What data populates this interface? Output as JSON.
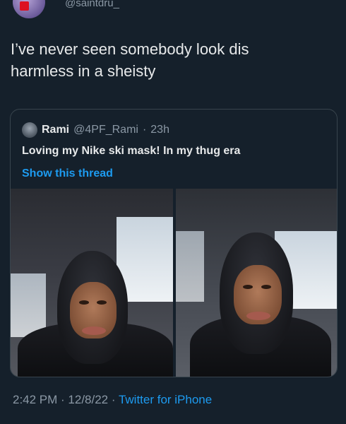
{
  "header": {
    "handle": "@saintdru_"
  },
  "tweet": {
    "text_line1": "I’ve never seen somebody look dis",
    "text_line2": "harmless in a sheisty"
  },
  "quote": {
    "name": "Rami",
    "handle": "@4PF_Rami",
    "separator": "·",
    "time": "23h",
    "text": "Loving my Nike ski mask! In my thug era",
    "link": "Show this thread"
  },
  "footer": {
    "time": "2:42 PM · 12/8/22 · ",
    "source": "Twitter for iPhone"
  },
  "colors": {
    "background": "#15202b",
    "text": "#e7e9ea",
    "muted": "#8b98a5",
    "link": "#1d9bf0",
    "border": "#38444d"
  }
}
